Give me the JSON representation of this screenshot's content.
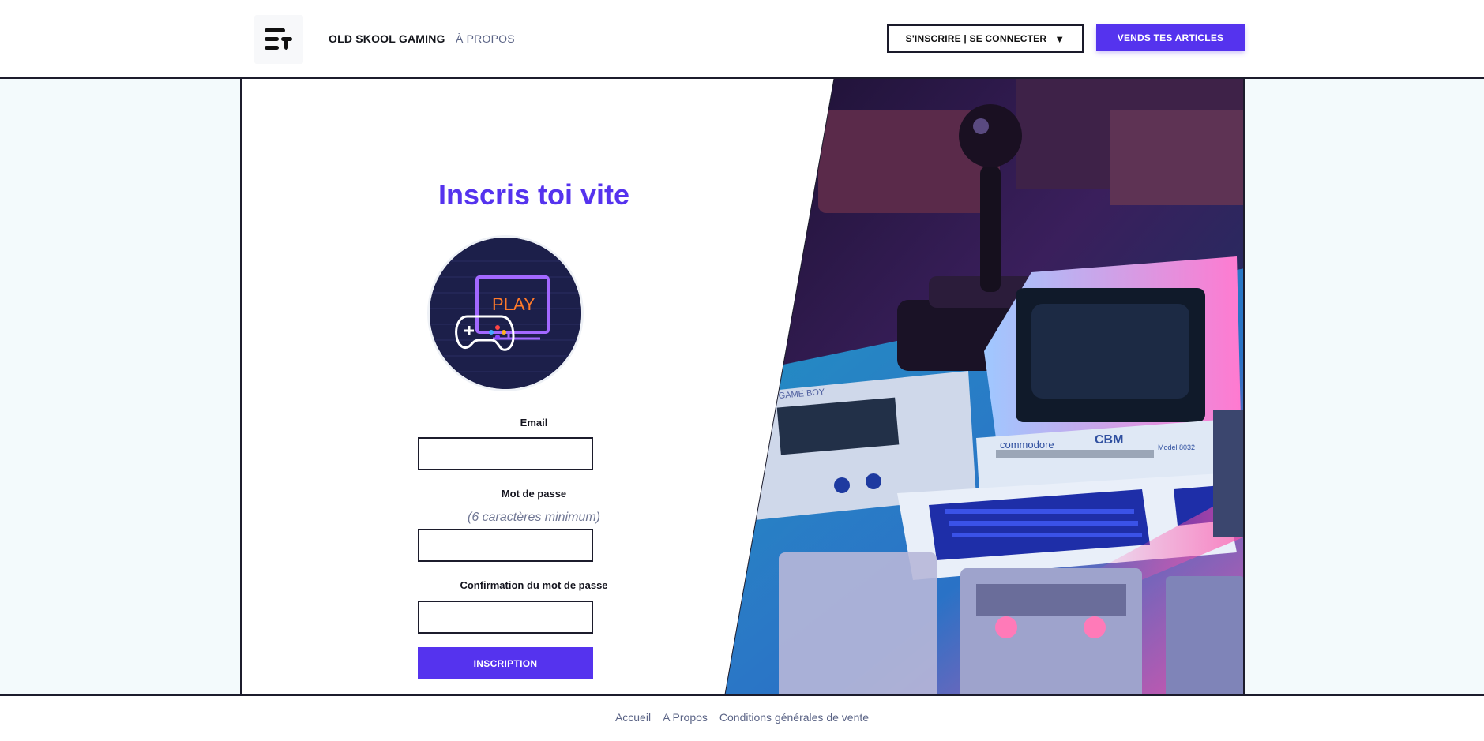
{
  "header": {
    "brand": "OLD SKOOL GAMING",
    "about": "À PROPOS",
    "signin_label": "S'INSCRIRE | SE CONNECTER",
    "signin_caret": "▼",
    "sell_label": "VENDS TES ARTICLES"
  },
  "form": {
    "title": "Inscris toi vite",
    "avatar_text": "PLAY",
    "email_label": "Email",
    "email_value": "",
    "password_label": "Mot de passe",
    "password_hint": "(6 caractères minimum)",
    "password_value": "",
    "confirm_label": "Confirmation du mot de passe",
    "confirm_value": "",
    "submit_label": "INSCRIPTION"
  },
  "hero_image": {
    "device_brand": "commodore",
    "device_model": "CBM",
    "device_submodel": "Model 8032",
    "handheld_label": "GAME BOY"
  },
  "footer": {
    "links": [
      "Accueil",
      "A Propos",
      "Conditions générales de vente"
    ]
  },
  "colors": {
    "accent": "#5533ee",
    "border": "#1c1c2c",
    "page_bg": "#f3fafc",
    "muted_text": "#5b6486"
  },
  "icons": [
    "logo-icon",
    "caret-down-icon",
    "gamepad-icon",
    "tv-icon"
  ]
}
